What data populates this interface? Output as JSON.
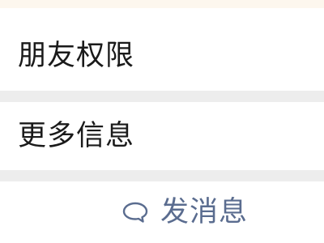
{
  "colors": {
    "top_strip": "#fdf7ee",
    "separator": "#ededed",
    "row_text": "#1a1a1a",
    "action_text": "#5a6c8f"
  },
  "rows": [
    {
      "label": "朋友权限",
      "icon": "none"
    },
    {
      "label": "更多信息",
      "icon": "none"
    }
  ],
  "action": {
    "label": "发消息",
    "icon": "chat-bubble-icon"
  }
}
